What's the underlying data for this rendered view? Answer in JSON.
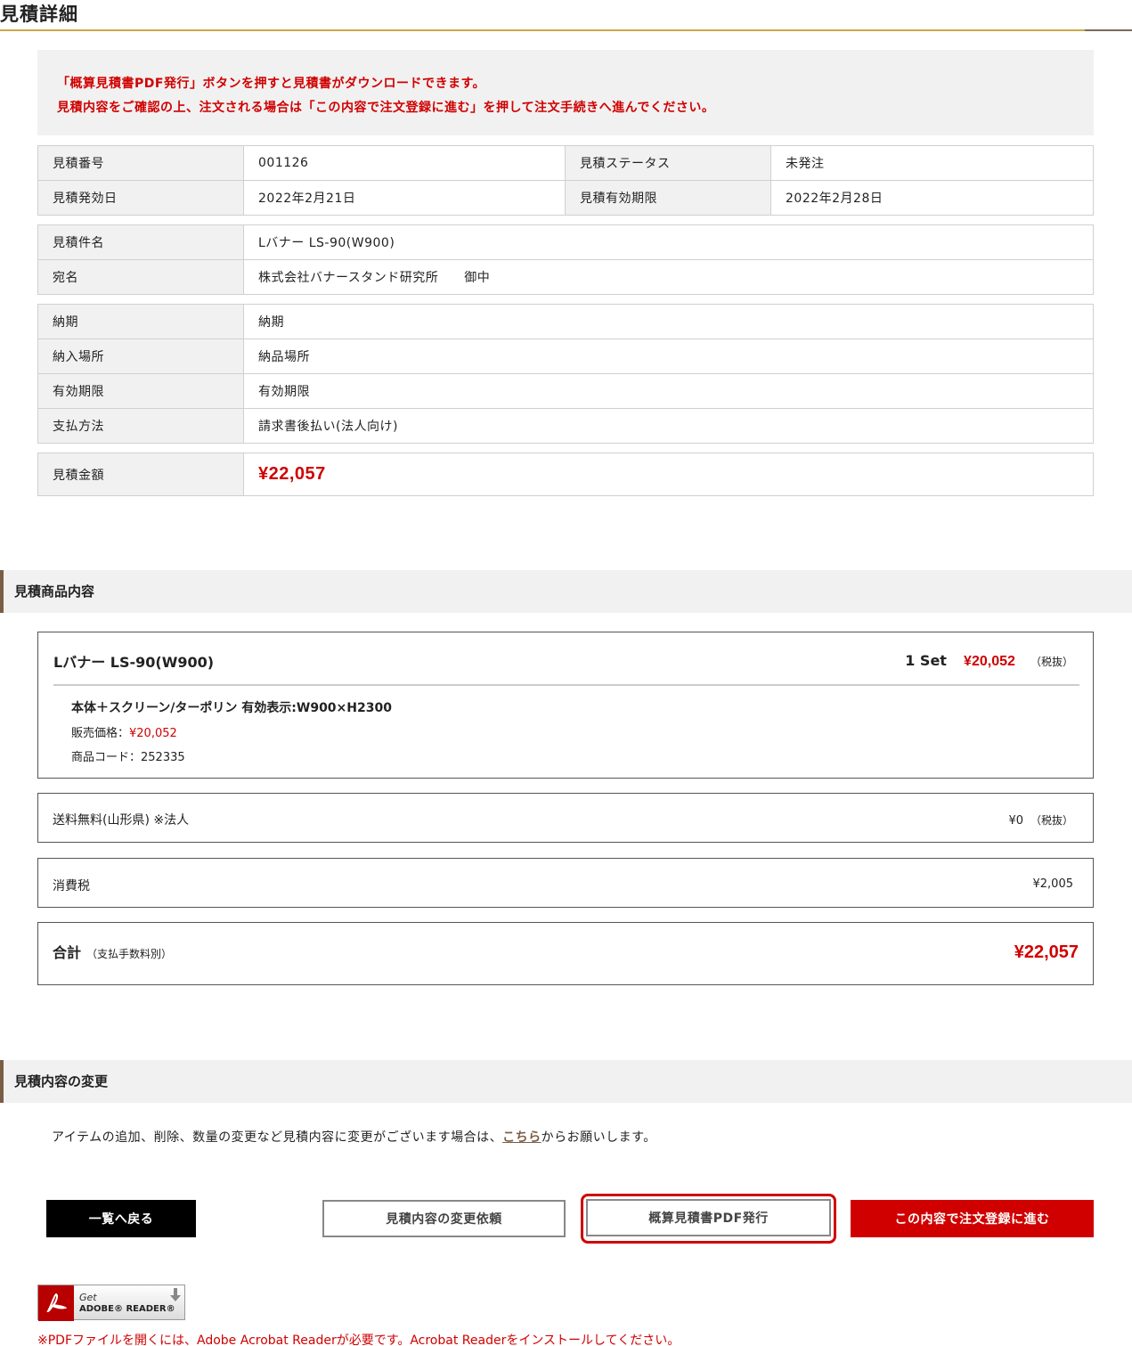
{
  "page": {
    "title": "見積詳細"
  },
  "notice": {
    "line1": "「概算見積書PDF発行」ボタンを押すと見積書がダウンロードできます。",
    "line2": "見積内容をご確認の上、注文される場合は「この内容で注文登録に進む」を押して注文手続きへ進んでください。"
  },
  "estimate": {
    "number_label": "見積番号",
    "number": "001126",
    "status_label": "見積ステータス",
    "status": "未発注",
    "issue_label": "見積発効日",
    "issue_date": "2022年2月21日",
    "expiry_label": "見積有効期限",
    "expiry_date": "2022年2月28日",
    "subject_label": "見積件名",
    "subject": "Lバナー LS-90(W900)",
    "addressee_label": "宛名",
    "addressee": "株式会社バナースタンド研究所　　御中",
    "delivery_label": "納期",
    "delivery": "納期",
    "place_label": "納入場所",
    "place": "納品場所",
    "validity_label": "有効期限",
    "validity": "有効期限",
    "payment_label": "支払方法",
    "payment": "請求書後払い(法人向け)",
    "amount_label": "見積金額",
    "amount": "¥22,057"
  },
  "items_section": {
    "heading": "見積商品内容",
    "product": {
      "name": "Lバナー LS-90(W900)",
      "qty": "1 Set",
      "price": "¥20,052",
      "tax": "（税抜）",
      "option": "本体＋スクリーン/ターポリン 有効表示:W900×H2300",
      "sale_label": "販売価格：",
      "sale_price": "¥20,052",
      "code": "商品コード：252335"
    },
    "shipping": {
      "label": "送料無料(山形県) ※法人",
      "value": "¥0",
      "tax": "（税抜）"
    },
    "consumption_tax": {
      "label": "消費税",
      "value": "¥2,005"
    },
    "total": {
      "label": "合計",
      "sub": "（支払手数料別）",
      "value": "¥22,057"
    }
  },
  "change_section": {
    "heading": "見積内容の変更",
    "text_before": "アイテムの追加、削除、数量の変更など見積内容に変更がございます場合は、",
    "link": "こちら",
    "text_after": "からお願いします。"
  },
  "buttons": {
    "back": "一覧へ戻る",
    "change_request": "見積内容の変更依頼",
    "pdf": "概算見積書PDF発行",
    "order": "この内容で注文登録に進む"
  },
  "adobe": {
    "get": "Get",
    "name": "ADOBE® READER®"
  },
  "pdf_note": "※PDFファイルを開くには、Adobe Acrobat Readerが必要です。Acrobat Readerをインストールしてください。",
  "colors": {
    "accent_red": "#d00000",
    "gold_rule": "#c9a94a",
    "section_bar": "#7a5e44"
  }
}
